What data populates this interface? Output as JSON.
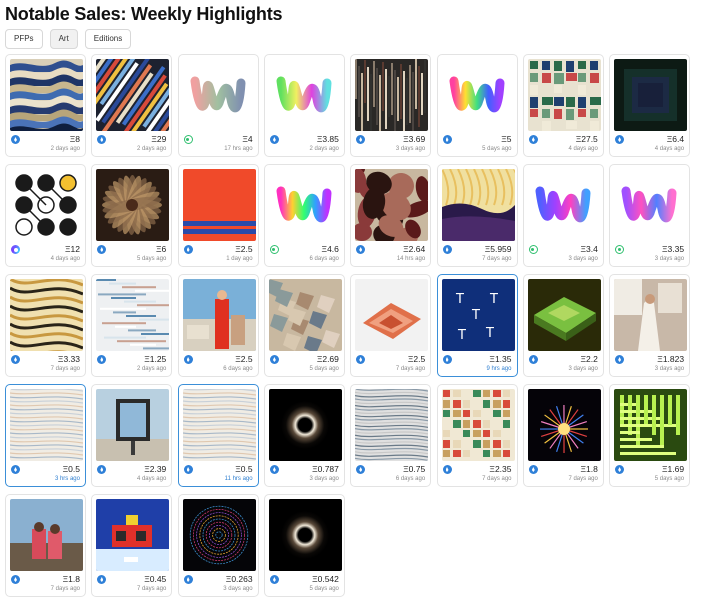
{
  "page": {
    "title": "Notable Sales: Weekly Highlights"
  },
  "filters": [
    "PFPs",
    "Art",
    "Editions"
  ],
  "sales": [
    {
      "chain": "eth",
      "price": "Ξ8",
      "time": "2 days ago",
      "art": "waves"
    },
    {
      "chain": "eth",
      "price": "Ξ29",
      "time": "2 days ago",
      "art": "stripes"
    },
    {
      "chain": "tez",
      "price": "Ξ4",
      "time": "17 hrs ago",
      "art": "squiggle-gray"
    },
    {
      "chain": "eth",
      "price": "Ξ3.85",
      "time": "2 days ago",
      "art": "squiggle-green"
    },
    {
      "chain": "eth",
      "price": "Ξ3.69",
      "time": "3 days ago",
      "art": "glitch-dark"
    },
    {
      "chain": "eth",
      "price": "Ξ5",
      "time": "5 days ago",
      "art": "squiggle-rainbow"
    },
    {
      "chain": "eth",
      "price": "Ξ27.5",
      "time": "4 days ago",
      "art": "patchwork"
    },
    {
      "chain": "eth",
      "price": "Ξ6.4",
      "time": "4 days ago",
      "art": "moon-square"
    },
    {
      "chain": "poly",
      "price": "Ξ12",
      "time": "4 days ago",
      "art": "dots-grid"
    },
    {
      "chain": "eth",
      "price": "Ξ6",
      "time": "5 days ago",
      "art": "flower-dark"
    },
    {
      "chain": "eth",
      "price": "Ξ2.5",
      "time": "1 day ago",
      "art": "red-stripes"
    },
    {
      "chain": "tez",
      "price": "Ξ4.6",
      "time": "6 days ago",
      "art": "squiggle-spectrum"
    },
    {
      "chain": "eth",
      "price": "Ξ2.64",
      "time": "14 hrs ago",
      "art": "camo-maroon"
    },
    {
      "chain": "eth",
      "price": "Ξ5.959",
      "time": "7 days ago",
      "art": "landscape-sun"
    },
    {
      "chain": "tez",
      "price": "Ξ3.4",
      "time": "3 days ago",
      "art": "squiggle-blue"
    },
    {
      "chain": "tez",
      "price": "Ξ3.35",
      "time": "3 days ago",
      "art": "squiggle-pink"
    },
    {
      "chain": "eth",
      "price": "Ξ3.33",
      "time": "7 days ago",
      "art": "marble-gold"
    },
    {
      "chain": "eth",
      "price": "Ξ1.25",
      "time": "2 days ago",
      "art": "glitch-light"
    },
    {
      "chain": "eth",
      "price": "Ξ2.5",
      "time": "6 days ago",
      "art": "photo-fashion"
    },
    {
      "chain": "eth",
      "price": "Ξ2.69",
      "time": "5 days ago",
      "art": "collage-muted"
    },
    {
      "chain": "eth",
      "price": "Ξ2.5",
      "time": "7 days ago",
      "art": "terrain-orange"
    },
    {
      "chain": "eth",
      "price": "Ξ1.35",
      "time": "9 hrs ago",
      "art": "t-letters",
      "highlight": true,
      "timeBlue": true
    },
    {
      "chain": "eth",
      "price": "Ξ2.2",
      "time": "3 days ago",
      "art": "terrain-green"
    },
    {
      "chain": "eth",
      "price": "Ξ1.823",
      "time": "3 days ago",
      "art": "photo-bride"
    },
    {
      "chain": "eth",
      "price": "Ξ0.5",
      "time": "3 hrs ago",
      "art": "map-light",
      "highlight": true,
      "timeBlue": true
    },
    {
      "chain": "eth",
      "price": "Ξ2.39",
      "time": "4 days ago",
      "art": "photo-billboard"
    },
    {
      "chain": "eth",
      "price": "Ξ0.5",
      "time": "11 hrs ago",
      "art": "map-light",
      "highlight": true,
      "timeBlue": true
    },
    {
      "chain": "eth",
      "price": "Ξ0.787",
      "time": "3 days ago",
      "art": "black-hole"
    },
    {
      "chain": "eth",
      "price": "Ξ0.75",
      "time": "6 days ago",
      "art": "map-gray"
    },
    {
      "chain": "eth",
      "price": "Ξ2.35",
      "time": "7 days ago",
      "art": "patch-red-green"
    },
    {
      "chain": "eth",
      "price": "Ξ1.8",
      "time": "7 days ago",
      "art": "fireworks"
    },
    {
      "chain": "eth",
      "price": "Ξ1.69",
      "time": "5 days ago",
      "art": "maze-green"
    },
    {
      "chain": "eth",
      "price": "Ξ1.8",
      "time": "7 days ago",
      "art": "photo-beach"
    },
    {
      "chain": "eth",
      "price": "Ξ0.45",
      "time": "7 days ago",
      "art": "pixel-boat"
    },
    {
      "chain": "eth",
      "price": "Ξ0.263",
      "time": "3 days ago",
      "art": "spiral-dark"
    },
    {
      "chain": "eth",
      "price": "Ξ0.542",
      "time": "5 days ago",
      "art": "black-hole"
    }
  ]
}
